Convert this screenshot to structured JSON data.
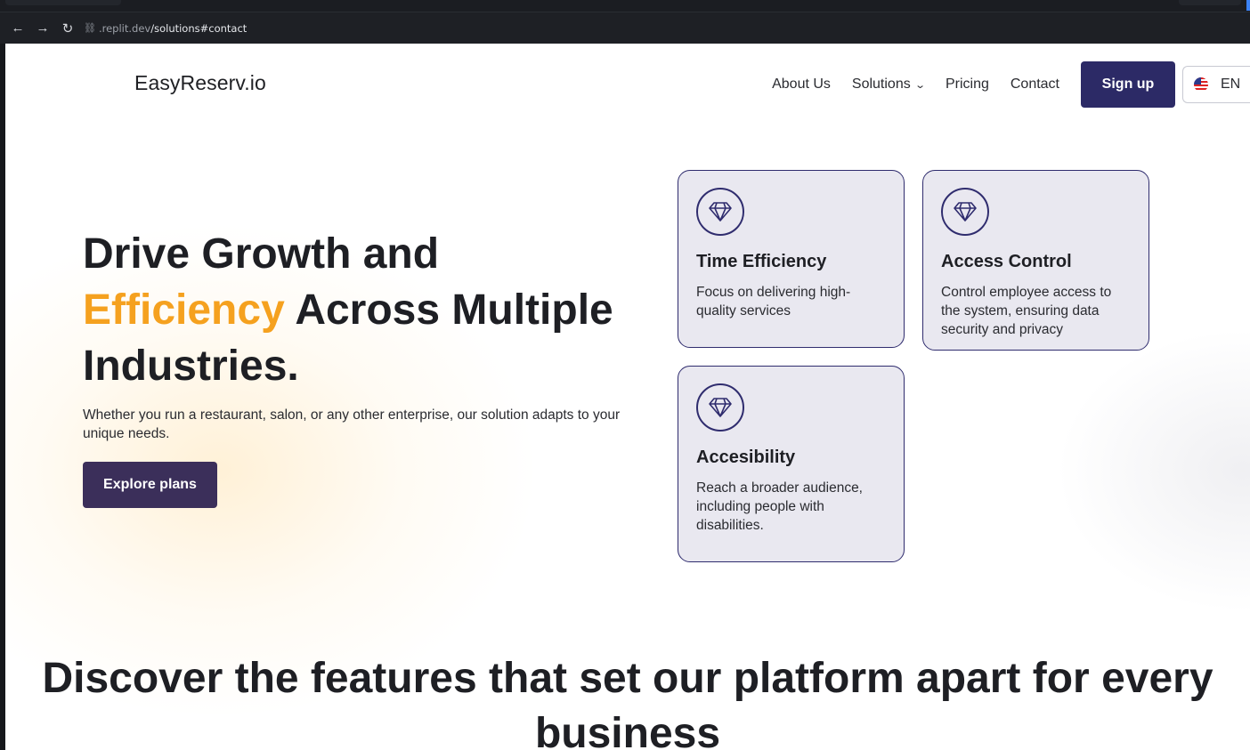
{
  "browser": {
    "url_host": ".replit.dev",
    "url_path": "/solutions#contact",
    "back_icon": "←",
    "forward_icon": "→",
    "reload_icon": "↻",
    "link_icon": "⛓"
  },
  "header": {
    "logo": "EasyReserv.io",
    "nav": {
      "about": "About Us",
      "solutions": "Solutions",
      "pricing": "Pricing",
      "contact": "Contact"
    },
    "signup_label": "Sign up",
    "language": "EN"
  },
  "hero": {
    "title_line1": "Drive Growth and",
    "title_accent": "Efficiency",
    "title_rest": " Across Multiple Industries.",
    "subtitle": "Whether you run a restaurant, salon, or any other enterprise, our solution adapts to your unique needs.",
    "cta_label": "Explore plans",
    "accent_color": "#f5a11f"
  },
  "cards": [
    {
      "title": "Time Efficiency",
      "text": "Focus on delivering high-quality services",
      "icon": "diamond-icon"
    },
    {
      "title": "Access Control",
      "text": "Control employee access to the system, ensuring data security and privacy",
      "icon": "diamond-icon"
    },
    {
      "title": "Accesibility",
      "text": "Reach a broader audience, including people with disabilities.",
      "icon": "diamond-icon"
    }
  ],
  "features": {
    "title": "Discover the features that set our platform apart for every business"
  },
  "colors": {
    "primary": "#2c2a66",
    "cta": "#3b2f5a",
    "card_bg": "#e9e8f0"
  }
}
